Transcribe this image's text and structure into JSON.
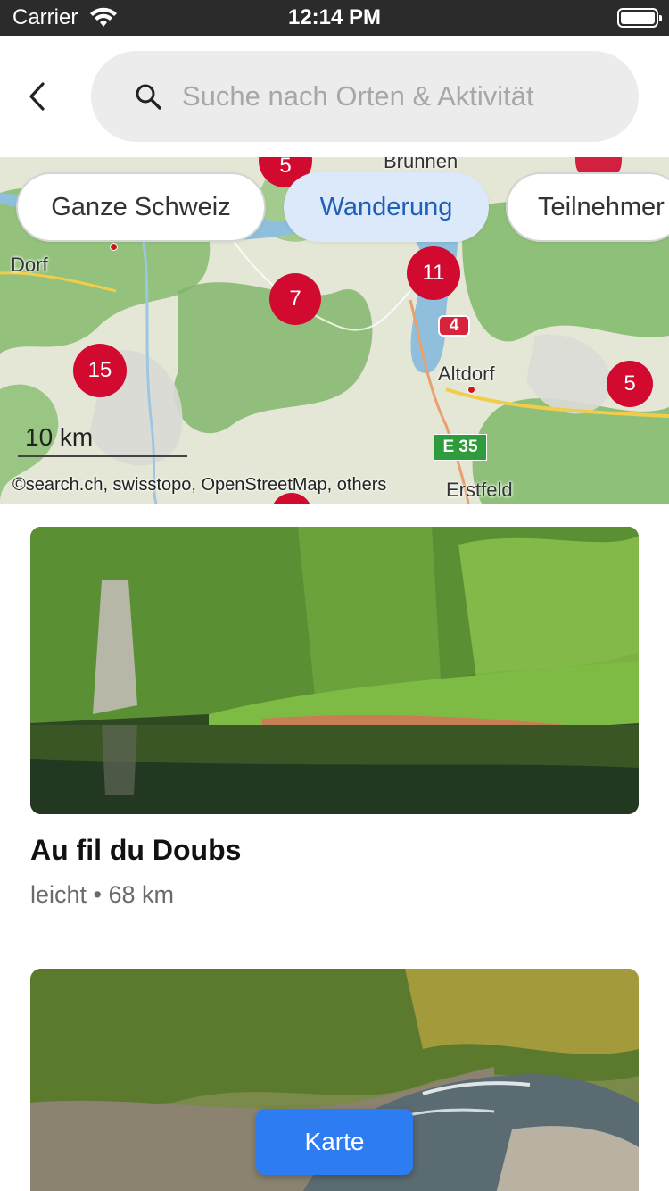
{
  "status_bar": {
    "carrier": "Carrier",
    "time": "12:14 PM",
    "wifi_icon": "wifi-icon",
    "battery_icon": "battery-icon"
  },
  "header": {
    "back_icon": "chevron-left-icon",
    "search_icon": "search-icon",
    "search_placeholder": "Suche nach Orten & Aktivität",
    "search_value": ""
  },
  "filters": {
    "chips": [
      {
        "label": "Ganze Schweiz",
        "active": false
      },
      {
        "label": "Wanderung",
        "active": true
      },
      {
        "label": "Teilnehmer",
        "active": false
      }
    ]
  },
  "map": {
    "clusters": [
      "5",
      "7",
      "11",
      "15",
      "5"
    ],
    "places": [
      "Brunnen",
      "Dorf",
      "Altdorf",
      "Erstfeld"
    ],
    "road_signs": [
      "4",
      "E 35"
    ],
    "scale": "10 km",
    "attribution": "©search.ch, swisstopo, OpenStreetMap, others",
    "colors": {
      "cluster": "#d20a30",
      "lake": "#8fbfdc",
      "forest": "#7fb96a"
    }
  },
  "cards": [
    {
      "title": "Au fil du Doubs",
      "difficulty": "leicht",
      "separator": "•",
      "distance": "68 km"
    },
    {
      "title": "",
      "difficulty": "",
      "separator": "",
      "distance": ""
    }
  ],
  "map_button": {
    "label": "Karte",
    "color": "#2d7cf1"
  }
}
